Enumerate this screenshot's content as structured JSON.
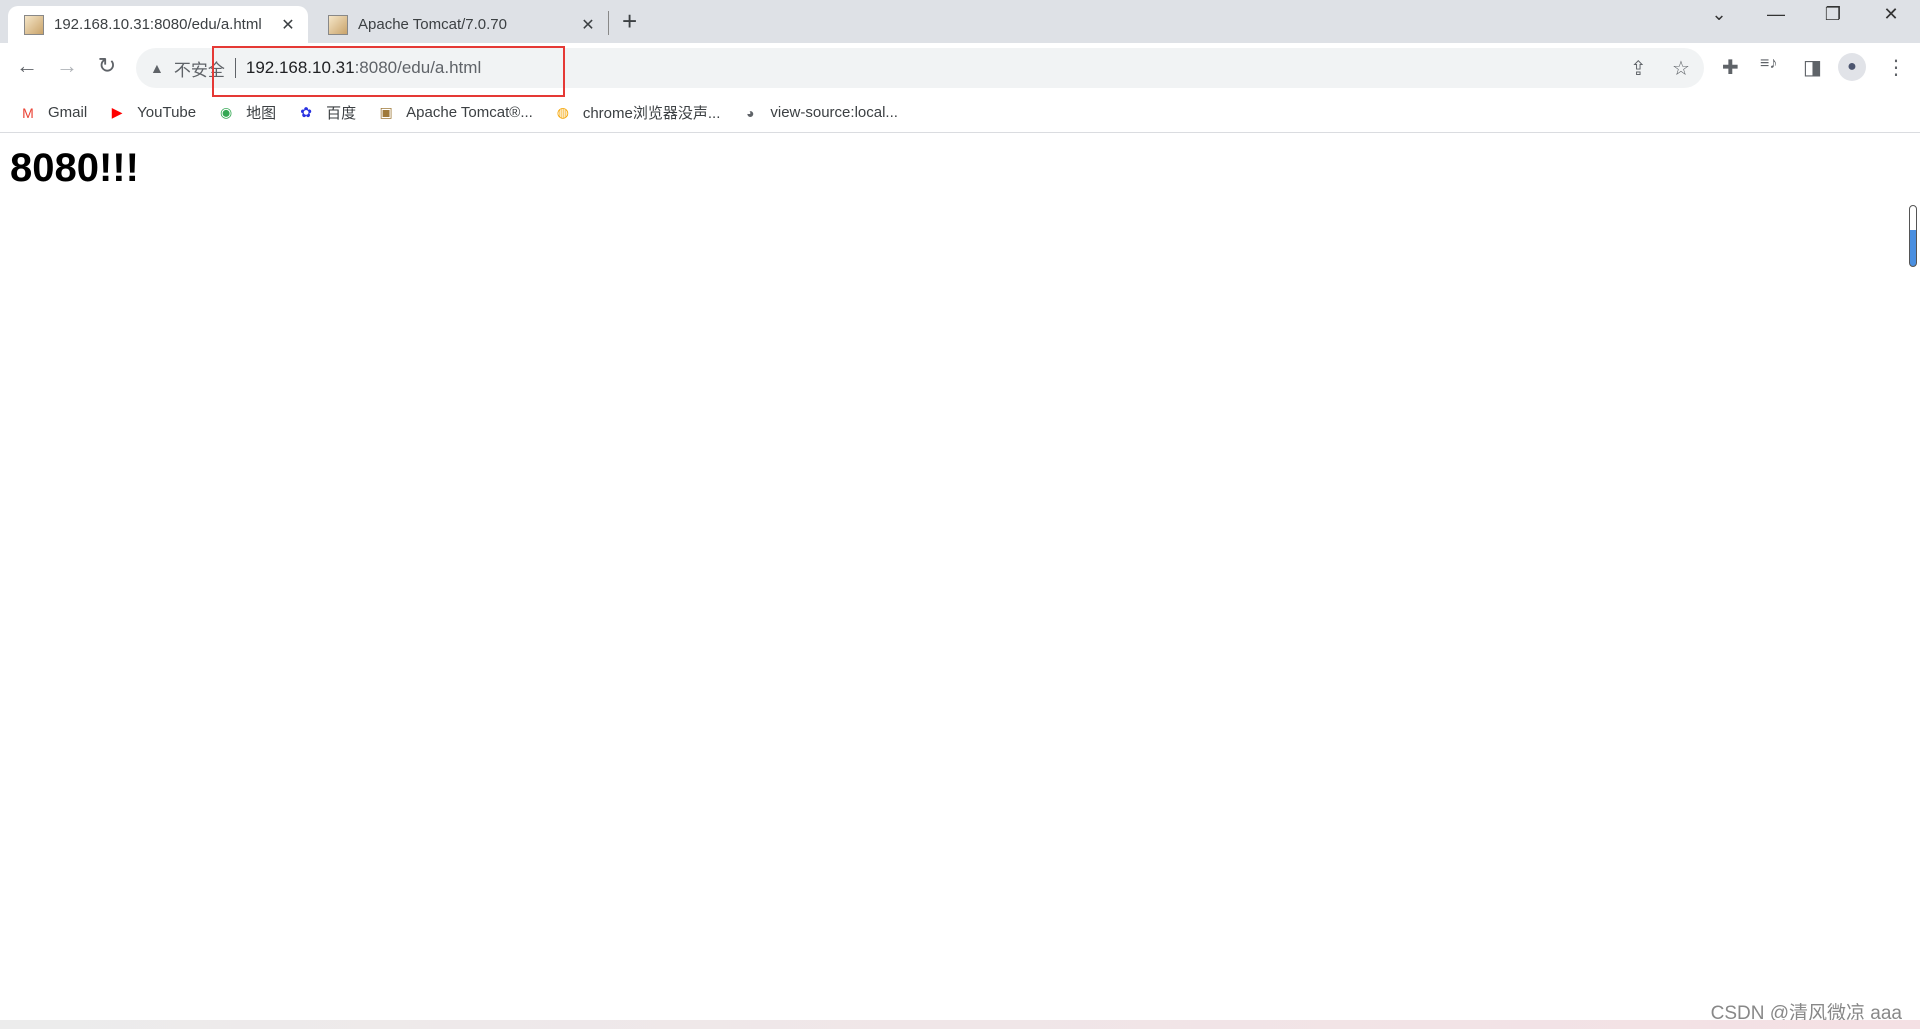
{
  "tabs": [
    {
      "title": "192.168.10.31:8080/edu/a.html",
      "active": true
    },
    {
      "title": "Apache Tomcat/7.0.70",
      "active": false
    }
  ],
  "tab_close": "✕",
  "new_tab": "+",
  "window": {
    "dropdown": "⌄",
    "minimize": "—",
    "restore": "❐",
    "close": "✕"
  },
  "nav": {
    "back": "←",
    "forward": "→",
    "reload": "↻"
  },
  "omnibox": {
    "security_icon": "▲",
    "security_label": "不安全",
    "url_host": "192.168.10.31",
    "url_rest": ":8080/edu/a.html",
    "share": "⇪",
    "star": "☆"
  },
  "toolbar_icons": {
    "extensions": "✚",
    "media": "≡♪",
    "sidepanel": "◨",
    "profile": "●",
    "menu": "⋮"
  },
  "bookmarks": [
    {
      "label": "Gmail",
      "icon": "M",
      "color": "#ea4335"
    },
    {
      "label": "YouTube",
      "icon": "▶",
      "color": "#ff0000"
    },
    {
      "label": "地图",
      "icon": "◉",
      "color": "#34a853"
    },
    {
      "label": "百度",
      "icon": "✿",
      "color": "#2932e1"
    },
    {
      "label": "Apache Tomcat®...",
      "icon": "▣",
      "color": "#a07a3a"
    },
    {
      "label": "chrome浏览器没声...",
      "icon": "◍",
      "color": "#f4a300"
    },
    {
      "label": "view-source:local...",
      "icon": "◕",
      "color": "#5f6368"
    }
  ],
  "page": {
    "heading": "8080!!!"
  },
  "watermark": "CSDN @清风微凉 aaa",
  "highlight_color": "#e53935"
}
